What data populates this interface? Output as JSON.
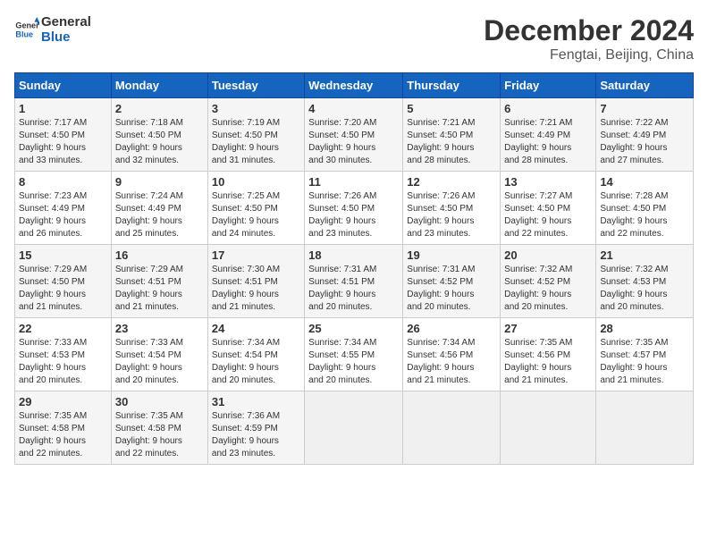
{
  "header": {
    "logo_line1": "General",
    "logo_line2": "Blue",
    "title": "December 2024",
    "subtitle": "Fengtai, Beijing, China"
  },
  "days_of_week": [
    "Sunday",
    "Monday",
    "Tuesday",
    "Wednesday",
    "Thursday",
    "Friday",
    "Saturday"
  ],
  "weeks": [
    [
      {
        "day": "1",
        "info": "Sunrise: 7:17 AM\nSunset: 4:50 PM\nDaylight: 9 hours\nand 33 minutes."
      },
      {
        "day": "2",
        "info": "Sunrise: 7:18 AM\nSunset: 4:50 PM\nDaylight: 9 hours\nand 32 minutes."
      },
      {
        "day": "3",
        "info": "Sunrise: 7:19 AM\nSunset: 4:50 PM\nDaylight: 9 hours\nand 31 minutes."
      },
      {
        "day": "4",
        "info": "Sunrise: 7:20 AM\nSunset: 4:50 PM\nDaylight: 9 hours\nand 30 minutes."
      },
      {
        "day": "5",
        "info": "Sunrise: 7:21 AM\nSunset: 4:50 PM\nDaylight: 9 hours\nand 28 minutes."
      },
      {
        "day": "6",
        "info": "Sunrise: 7:21 AM\nSunset: 4:49 PM\nDaylight: 9 hours\nand 28 minutes."
      },
      {
        "day": "7",
        "info": "Sunrise: 7:22 AM\nSunset: 4:49 PM\nDaylight: 9 hours\nand 27 minutes."
      }
    ],
    [
      {
        "day": "8",
        "info": "Sunrise: 7:23 AM\nSunset: 4:49 PM\nDaylight: 9 hours\nand 26 minutes."
      },
      {
        "day": "9",
        "info": "Sunrise: 7:24 AM\nSunset: 4:49 PM\nDaylight: 9 hours\nand 25 minutes."
      },
      {
        "day": "10",
        "info": "Sunrise: 7:25 AM\nSunset: 4:50 PM\nDaylight: 9 hours\nand 24 minutes."
      },
      {
        "day": "11",
        "info": "Sunrise: 7:26 AM\nSunset: 4:50 PM\nDaylight: 9 hours\nand 23 minutes."
      },
      {
        "day": "12",
        "info": "Sunrise: 7:26 AM\nSunset: 4:50 PM\nDaylight: 9 hours\nand 23 minutes."
      },
      {
        "day": "13",
        "info": "Sunrise: 7:27 AM\nSunset: 4:50 PM\nDaylight: 9 hours\nand 22 minutes."
      },
      {
        "day": "14",
        "info": "Sunrise: 7:28 AM\nSunset: 4:50 PM\nDaylight: 9 hours\nand 22 minutes."
      }
    ],
    [
      {
        "day": "15",
        "info": "Sunrise: 7:29 AM\nSunset: 4:50 PM\nDaylight: 9 hours\nand 21 minutes."
      },
      {
        "day": "16",
        "info": "Sunrise: 7:29 AM\nSunset: 4:51 PM\nDaylight: 9 hours\nand 21 minutes."
      },
      {
        "day": "17",
        "info": "Sunrise: 7:30 AM\nSunset: 4:51 PM\nDaylight: 9 hours\nand 21 minutes."
      },
      {
        "day": "18",
        "info": "Sunrise: 7:31 AM\nSunset: 4:51 PM\nDaylight: 9 hours\nand 20 minutes."
      },
      {
        "day": "19",
        "info": "Sunrise: 7:31 AM\nSunset: 4:52 PM\nDaylight: 9 hours\nand 20 minutes."
      },
      {
        "day": "20",
        "info": "Sunrise: 7:32 AM\nSunset: 4:52 PM\nDaylight: 9 hours\nand 20 minutes."
      },
      {
        "day": "21",
        "info": "Sunrise: 7:32 AM\nSunset: 4:53 PM\nDaylight: 9 hours\nand 20 minutes."
      }
    ],
    [
      {
        "day": "22",
        "info": "Sunrise: 7:33 AM\nSunset: 4:53 PM\nDaylight: 9 hours\nand 20 minutes."
      },
      {
        "day": "23",
        "info": "Sunrise: 7:33 AM\nSunset: 4:54 PM\nDaylight: 9 hours\nand 20 minutes."
      },
      {
        "day": "24",
        "info": "Sunrise: 7:34 AM\nSunset: 4:54 PM\nDaylight: 9 hours\nand 20 minutes."
      },
      {
        "day": "25",
        "info": "Sunrise: 7:34 AM\nSunset: 4:55 PM\nDaylight: 9 hours\nand 20 minutes."
      },
      {
        "day": "26",
        "info": "Sunrise: 7:34 AM\nSunset: 4:56 PM\nDaylight: 9 hours\nand 21 minutes."
      },
      {
        "day": "27",
        "info": "Sunrise: 7:35 AM\nSunset: 4:56 PM\nDaylight: 9 hours\nand 21 minutes."
      },
      {
        "day": "28",
        "info": "Sunrise: 7:35 AM\nSunset: 4:57 PM\nDaylight: 9 hours\nand 21 minutes."
      }
    ],
    [
      {
        "day": "29",
        "info": "Sunrise: 7:35 AM\nSunset: 4:58 PM\nDaylight: 9 hours\nand 22 minutes."
      },
      {
        "day": "30",
        "info": "Sunrise: 7:35 AM\nSunset: 4:58 PM\nDaylight: 9 hours\nand 22 minutes."
      },
      {
        "day": "31",
        "info": "Sunrise: 7:36 AM\nSunset: 4:59 PM\nDaylight: 9 hours\nand 23 minutes."
      },
      {
        "day": "",
        "info": ""
      },
      {
        "day": "",
        "info": ""
      },
      {
        "day": "",
        "info": ""
      },
      {
        "day": "",
        "info": ""
      }
    ]
  ]
}
